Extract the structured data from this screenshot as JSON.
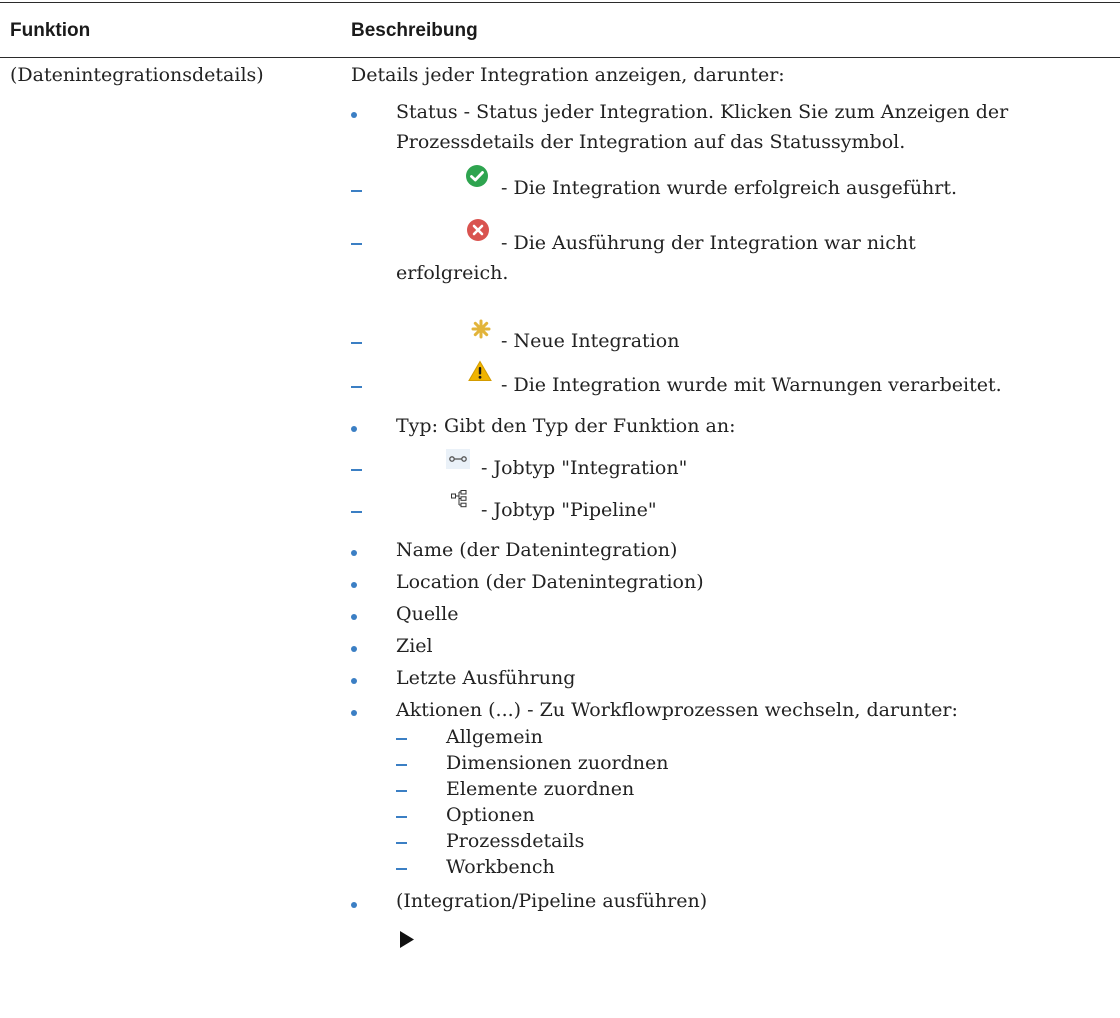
{
  "table": {
    "headers": {
      "function": "Funktion",
      "description": "Beschreibung"
    },
    "row": {
      "function": "(Datenintegrationsdetails)",
      "intro": "Details jeder Integration anzeigen, darunter:",
      "status_line1": "Status - Status jeder Integration. Klicken Sie zum Anzeigen der",
      "status_line2": "Prozessdetails der Integration auf das Statussymbol.",
      "status_items": {
        "success": "- Die Integration wurde erfolgreich ausgeführt.",
        "failed_line1": "- Die Ausführung der Integration war nicht",
        "failed_line2": "erfolgreich.",
        "new": "- Neue Integration",
        "warning": "- Die Integration wurde mit Warnungen verarbeitet."
      },
      "type_line": "Typ: Gibt den Typ der Funktion an:",
      "type_items": {
        "integration": "- Jobtyp \"Integration\"",
        "pipeline": "- Jobtyp \"Pipeline\""
      },
      "bullets": [
        "Name (der Datenintegration)",
        "Location (der Datenintegration)",
        "Quelle",
        "Ziel",
        "Letzte Ausführung",
        "Aktionen (...) - Zu Workflowprozessen wechseln, darunter:"
      ],
      "actions": [
        "Allgemein",
        "Dimensionen zuordnen",
        "Elemente zuordnen",
        "Optionen",
        "Prozessdetails",
        "Workbench"
      ],
      "run_item": "(Integration/Pipeline ausführen)"
    },
    "icons": {
      "success": "check-circle-icon",
      "failed": "x-circle-icon",
      "new": "asterisk-icon",
      "warning": "warning-triangle-icon",
      "integration_job": "integration-job-icon",
      "pipeline_job": "pipeline-job-icon",
      "run": "play-icon"
    },
    "colors": {
      "bullet": "#3b7fc4",
      "success": "#2ea44f",
      "failed": "#d9534f",
      "new": "#e2b43a",
      "warning": "#f0b400"
    }
  }
}
